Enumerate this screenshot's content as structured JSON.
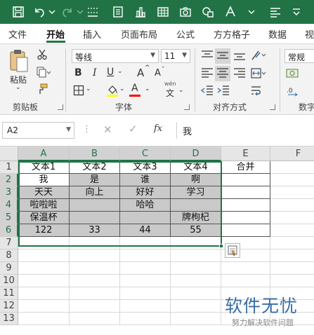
{
  "qat": {
    "icons": [
      "save-icon",
      "undo-icon",
      "redo-icon",
      "format-painter-icon",
      "form-icon",
      "chart-icon",
      "table-icon",
      "camera-icon",
      "shape-icon",
      "text-icon",
      "align-left-icon"
    ]
  },
  "tabs": [
    {
      "label": "文件"
    },
    {
      "label": "开始"
    },
    {
      "label": "插入"
    },
    {
      "label": "页面布局"
    },
    {
      "label": "公式"
    },
    {
      "label": "方方格子"
    },
    {
      "label": "数据"
    },
    {
      "label": "视"
    }
  ],
  "ribbon": {
    "clipboard": {
      "paste_label": "粘贴",
      "group_label": "剪贴板"
    },
    "font": {
      "font_name": "等线",
      "font_size": "11",
      "bold": "B",
      "italic": "I",
      "underline": "U",
      "grow": "A",
      "shrink": "A",
      "font_color": "A",
      "phonetic": "wén",
      "phonetic_char": "文",
      "group_label": "字体",
      "fill_color": "#ffff00",
      "text_color": "#ff0000"
    },
    "alignment": {
      "group_label": "对齐方式"
    },
    "number": {
      "format": "常规",
      "group_label": "数字"
    }
  },
  "formula_bar": {
    "name_box": "A2",
    "fx": "fx",
    "content": "我"
  },
  "sheet": {
    "columns": [
      "A",
      "B",
      "C",
      "D",
      "E",
      "F"
    ],
    "rows": [
      "1",
      "2",
      "3",
      "4",
      "5",
      "6",
      "7",
      "8",
      "9",
      "10",
      "11",
      "12",
      "13"
    ],
    "cells": [
      [
        "文本1",
        "文本2",
        "文本3",
        "文本4",
        "合并"
      ],
      [
        "我",
        "是",
        "谁",
        "啊",
        ""
      ],
      [
        "天天",
        "向上",
        "好好",
        "学习",
        ""
      ],
      [
        "啦啦啦",
        "",
        "哈哈",
        "",
        ""
      ],
      [
        "保温杯",
        "",
        "",
        "牌枸杞",
        ""
      ],
      [
        "122",
        "33",
        "44",
        "55",
        ""
      ]
    ],
    "active_cell": "A2",
    "selection": "A2:D6",
    "highlight_color": "#c9c9c9",
    "accent_color": "#217346"
  },
  "watermark": {
    "title": "软件无忧",
    "subtitle": "努力解决软件问题"
  }
}
